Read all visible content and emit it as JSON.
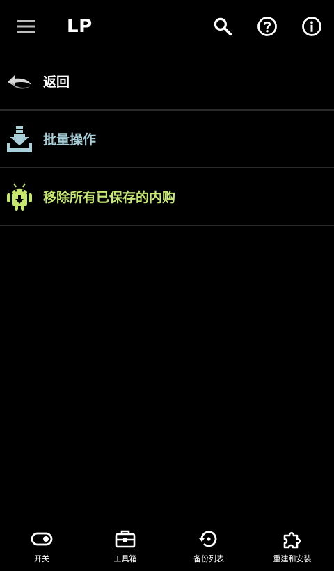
{
  "app": {
    "title": "LP"
  },
  "actions": {
    "menu_icon": "menu-icon",
    "search_icon": "search-icon",
    "help_icon": "help-icon",
    "info_icon": "info-icon"
  },
  "list": {
    "items": [
      {
        "label": "返回",
        "color": "#ffffff",
        "icon": "back-arrow-icon"
      },
      {
        "label": "批量操作",
        "color": "#a9cfd8",
        "icon": "download-icon"
      },
      {
        "label": "移除所有已保存的内购",
        "color": "#c7e86f",
        "icon": "android-download-icon"
      }
    ]
  },
  "bottom_nav": {
    "items": [
      {
        "label": "开关",
        "icon": "toggle-icon"
      },
      {
        "label": "工具箱",
        "icon": "toolbox-icon"
      },
      {
        "label": "备份列表",
        "icon": "restore-icon"
      },
      {
        "label": "重建和安装",
        "icon": "puzzle-icon"
      }
    ]
  }
}
